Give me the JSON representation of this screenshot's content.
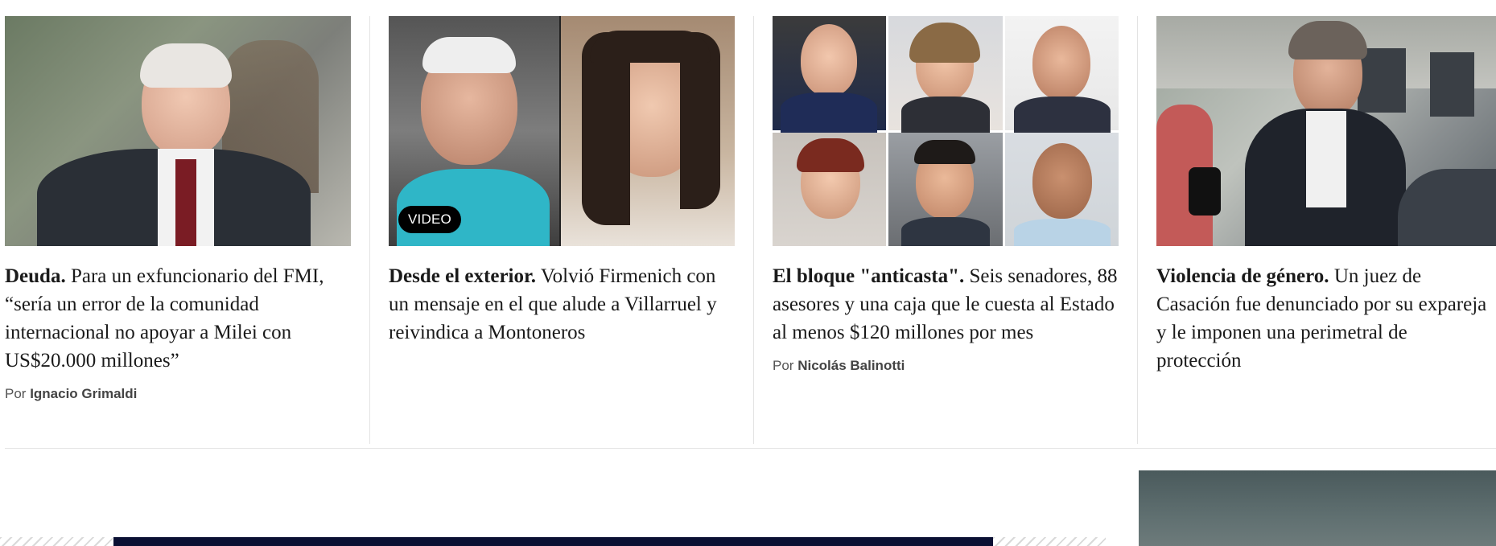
{
  "articles": [
    {
      "kicker": "Deuda.",
      "title": " Para un exfuncionario del FMI, “sería un error de la comunidad internacional no apoyar a Milei con US$20.000 millones”",
      "byline_prefix": "Por ",
      "author": "Ignacio Grimaldi"
    },
    {
      "kicker": "Desde el exterior.",
      "title": " Volvió Firmenich con un mensaje en el que alude a Villarruel y reivindica a Montoneros",
      "badge": "VIDEO"
    },
    {
      "kicker": "El bloque \"anticasta\".",
      "title": " Seis senadores, 88 asesores y una caja que le cuesta al Estado al menos $120 millones por mes",
      "byline_prefix": "Por ",
      "author": "Nicolás Balinotti"
    },
    {
      "kicker": "Violencia de género.",
      "title": " Un juez de Casación fue denunciado por su expareja y le imponen una perimetral de protección"
    }
  ],
  "colors": {
    "text": "#1a1a1a",
    "divider": "#e3e3e3",
    "badge_bg": "#000000",
    "banner": "#0a1033"
  }
}
